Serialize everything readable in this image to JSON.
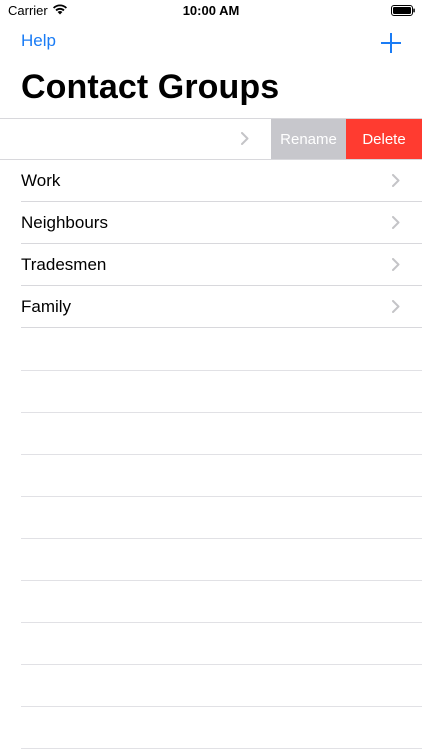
{
  "status_bar": {
    "carrier": "Carrier",
    "time": "10:00 AM",
    "wifi_icon": "wifi-icon",
    "battery_icon": "battery-icon"
  },
  "nav": {
    "left_button": "Help",
    "right_button_icon": "plus-icon"
  },
  "title": "Contact Groups",
  "swiped_row": {
    "label": "",
    "actions": [
      "Rename",
      "Delete"
    ]
  },
  "groups": [
    {
      "label": "Work"
    },
    {
      "label": "Neighbours"
    },
    {
      "label": "Tradesmen"
    },
    {
      "label": "Family"
    }
  ],
  "colors": {
    "accent": "#1a7cf5",
    "rename_action": "#c7c7cc",
    "delete_action": "#ff3b30",
    "separator": "#d8d8dc",
    "chevron": "#c4c4c7"
  }
}
